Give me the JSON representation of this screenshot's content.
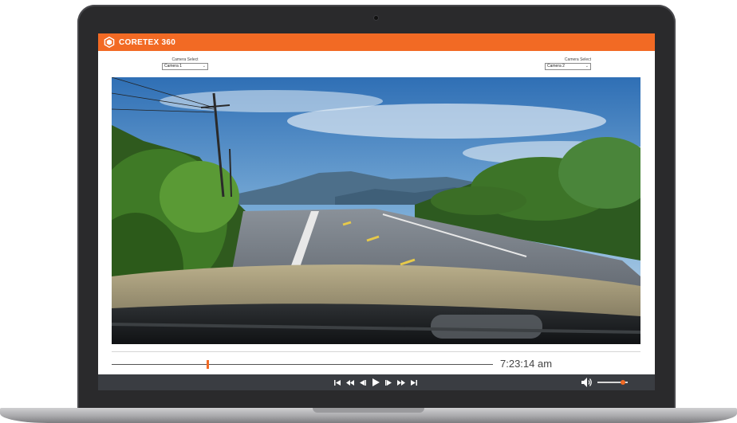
{
  "app": {
    "brand": "CORETEX 360",
    "brand_color": "#f26a24",
    "logo_icon": "hexagon-logo-icon"
  },
  "camera_left": {
    "label": "Camera Select",
    "value": "Camera 1"
  },
  "camera_right": {
    "label": "Camera Select",
    "value": "Camera 2"
  },
  "video": {
    "scene": "dashcam-road-view-image"
  },
  "timeline": {
    "time": "7:23:14 am",
    "progress": 0.25
  },
  "controls": {
    "buttons": [
      "skip-start-icon",
      "rewind-icon",
      "step-back-icon",
      "play-icon",
      "step-forward-icon",
      "fast-forward-icon",
      "skip-end-icon"
    ],
    "volume_level": 0.85
  }
}
